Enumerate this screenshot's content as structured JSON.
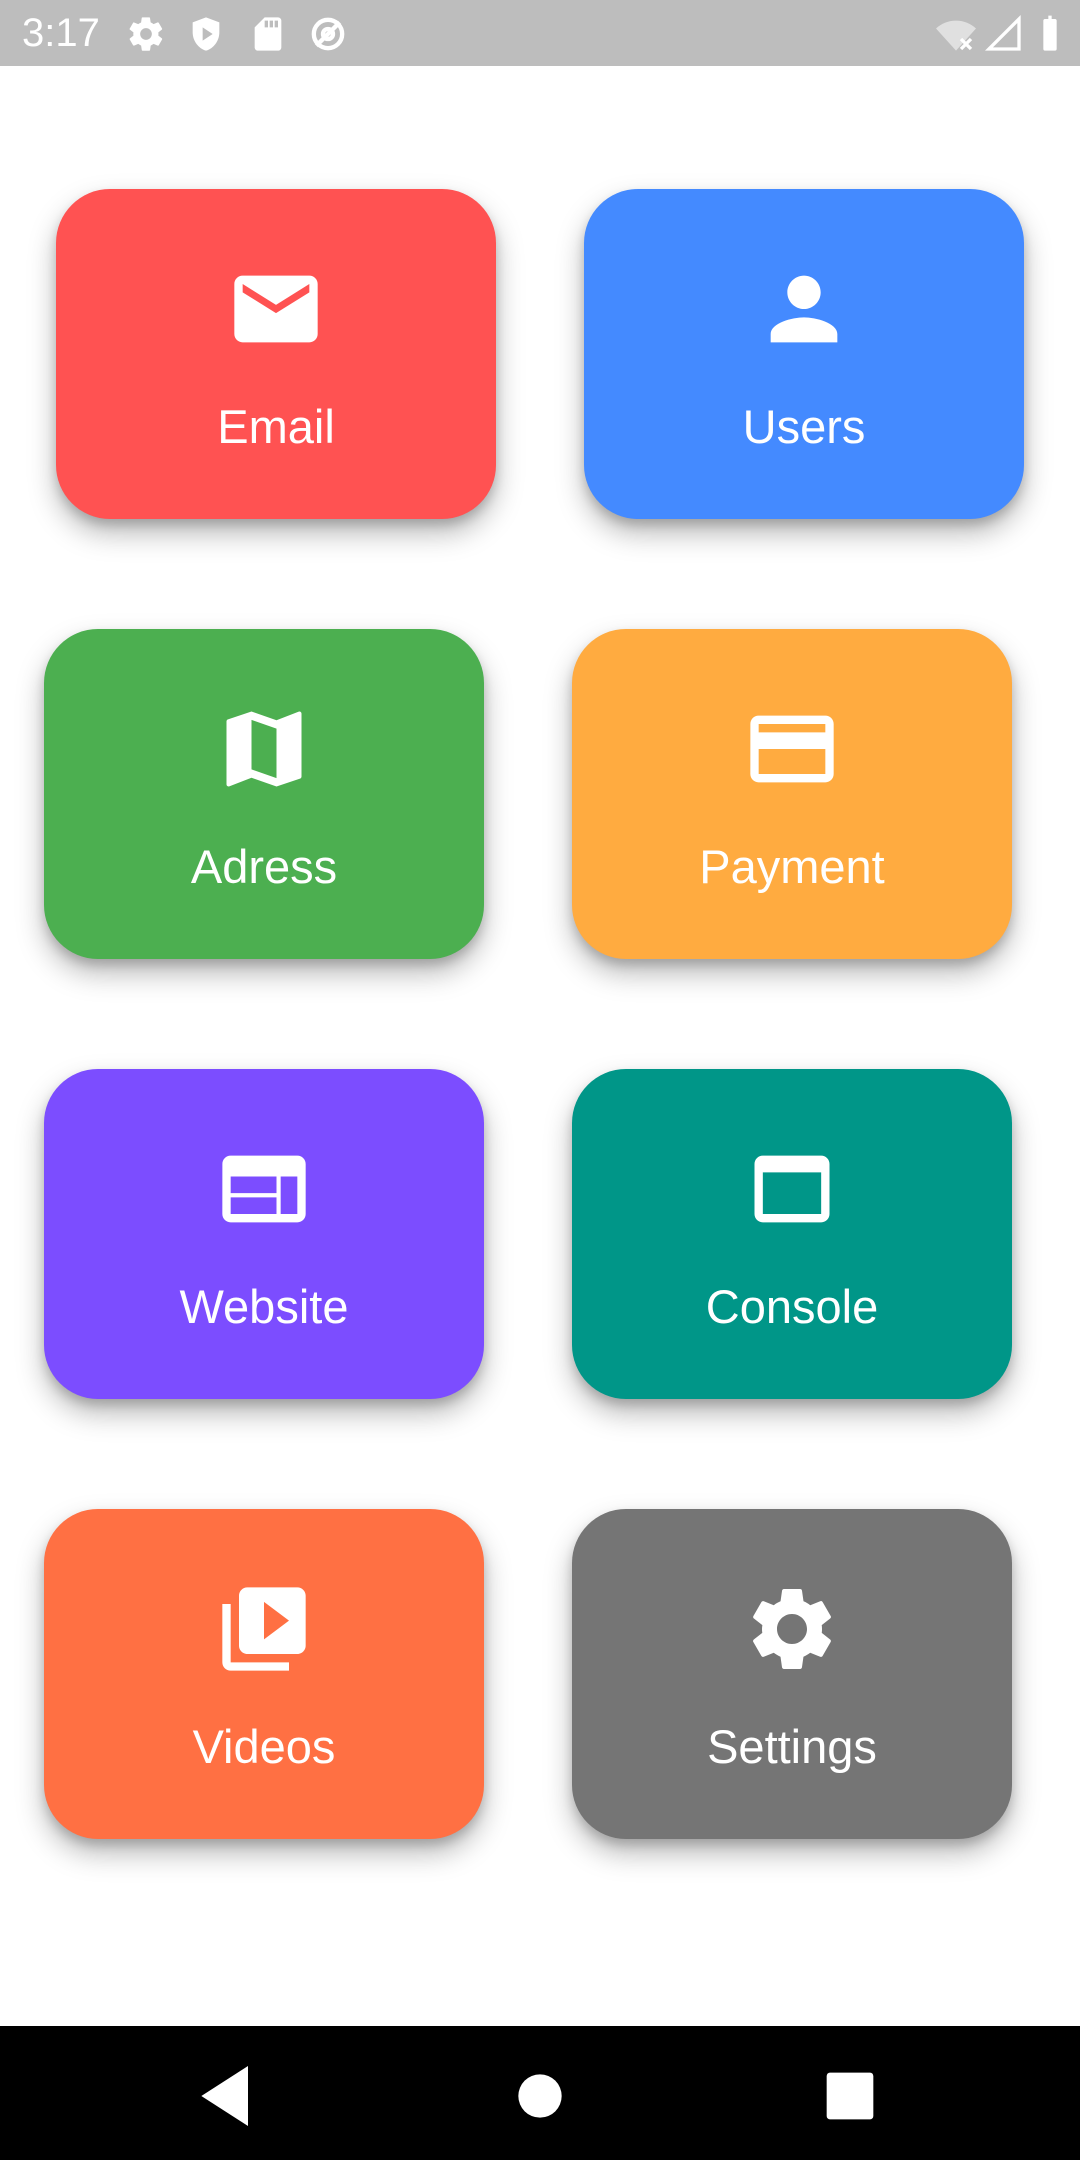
{
  "status_bar": {
    "time": "3:17",
    "icons": [
      "gear-icon",
      "play-protect-icon",
      "sd-card-icon",
      "no-sync-icon",
      "wifi-off-icon",
      "signal-icon",
      "battery-icon"
    ]
  },
  "tiles": [
    {
      "label": "Email",
      "icon": "mail-icon",
      "color": "#ff5252"
    },
    {
      "label": "Users",
      "icon": "person-icon",
      "color": "#448aff"
    },
    {
      "label": "Adress",
      "icon": "map-icon",
      "color": "#4caf50"
    },
    {
      "label": "Payment",
      "icon": "credit-card-icon",
      "color": "#ffab40"
    },
    {
      "label": "Website",
      "icon": "web-icon",
      "color": "#7c4dff"
    },
    {
      "label": "Console",
      "icon": "window-icon",
      "color": "#009688"
    },
    {
      "label": "Videos",
      "icon": "video-library-icon",
      "color": "#ff7043"
    },
    {
      "label": "Settings",
      "icon": "gear-icon",
      "color": "#757575"
    }
  ],
  "nav_bar": {
    "buttons": [
      "back-icon",
      "home-icon",
      "recents-icon"
    ]
  }
}
